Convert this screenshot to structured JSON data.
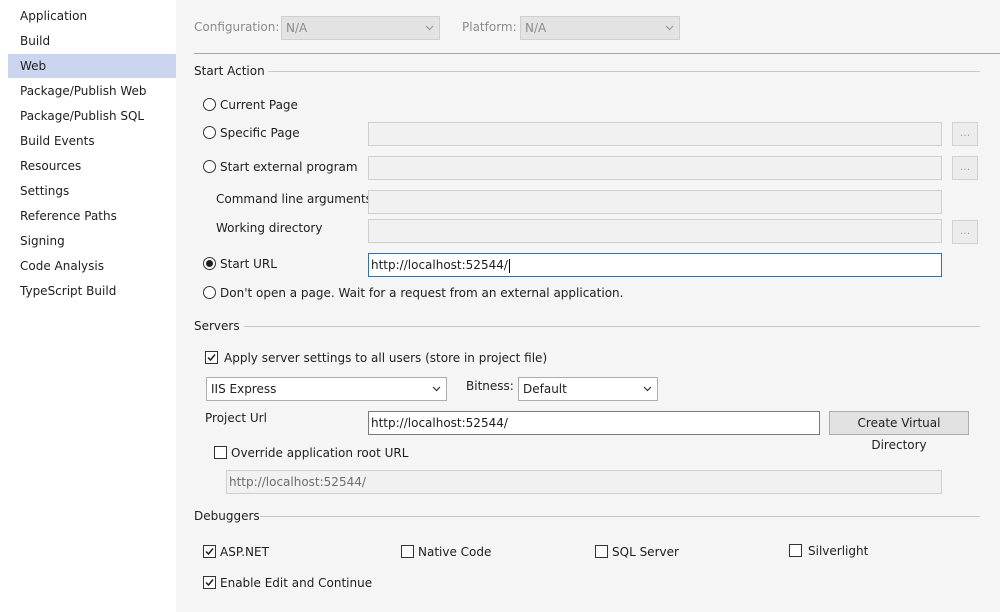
{
  "sidebar": {
    "items": [
      {
        "label": "Application"
      },
      {
        "label": "Build"
      },
      {
        "label": "Web"
      },
      {
        "label": "Package/Publish Web"
      },
      {
        "label": "Package/Publish SQL"
      },
      {
        "label": "Build Events"
      },
      {
        "label": "Resources"
      },
      {
        "label": "Settings"
      },
      {
        "label": "Reference Paths"
      },
      {
        "label": "Signing"
      },
      {
        "label": "Code Analysis"
      },
      {
        "label": "TypeScript Build"
      }
    ],
    "selected": "Web"
  },
  "header": {
    "configuration_label": "Configuration:",
    "configuration_value": "N/A",
    "platform_label": "Platform:",
    "platform_value": "N/A"
  },
  "start_action": {
    "title": "Start Action",
    "current_page": "Current Page",
    "specific_page": "Specific Page",
    "specific_page_value": "",
    "external_program": "Start external program",
    "external_program_value": "",
    "command_line_label": "Command line arguments",
    "command_line_value": "",
    "working_dir_label": "Working directory",
    "working_dir_value": "",
    "start_url": "Start URL",
    "start_url_value": "http://localhost:52544/",
    "dont_open": "Don't open a page.  Wait for a request from an external application.",
    "browse_label": "...",
    "selected": "start_url"
  },
  "servers": {
    "title": "Servers",
    "apply_settings_label": "Apply server settings to all users (store in project file)",
    "apply_settings_checked": true,
    "server_value": "IIS Express",
    "bitness_label": "Bitness:",
    "bitness_value": "Default",
    "project_url_label": "Project Url",
    "project_url_value": "http://localhost:52544/",
    "create_vdir_label": "Create Virtual Directory",
    "override_root_label": "Override application root URL",
    "override_root_checked": false,
    "override_root_value": "http://localhost:52544/"
  },
  "debuggers": {
    "title": "Debuggers",
    "aspnet": {
      "label": "ASP.NET",
      "checked": true
    },
    "native": {
      "label": "Native Code",
      "checked": false
    },
    "sql": {
      "label": "SQL Server",
      "checked": false
    },
    "silverlight": {
      "label": "Silverlight",
      "checked": false
    },
    "edit_continue": {
      "label": "Enable Edit and Continue",
      "checked": true
    }
  },
  "icons": {
    "dropdown": "chevron-down-icon",
    "check": "checkmark-icon"
  },
  "colors": {
    "selected_nav": "#ccd5f0",
    "focus_border": "#2f6fb4"
  }
}
